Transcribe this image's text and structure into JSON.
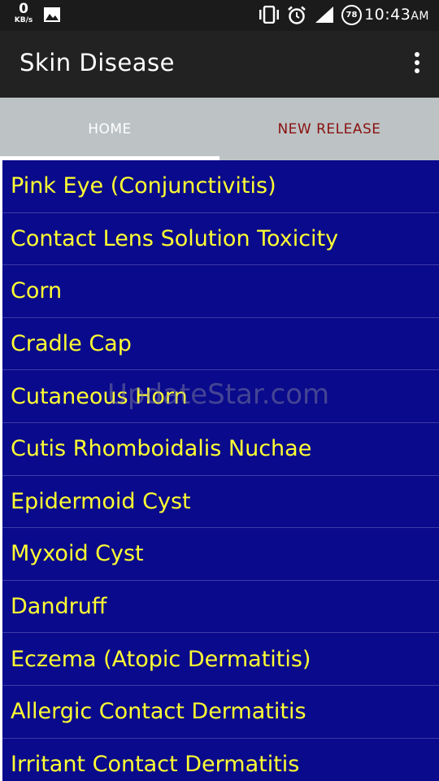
{
  "status_bar": {
    "net_speed": "0",
    "net_unit": "KB/s",
    "battery": "78",
    "time": "10:43",
    "ampm": "AM",
    "icons": [
      "image-icon",
      "vibrate-icon",
      "alarm-icon",
      "signal-icon",
      "battery-icon"
    ]
  },
  "toolbar": {
    "title": "Skin Disease",
    "menu_icon": "more-vert-icon"
  },
  "tabs": [
    {
      "label": "HOME",
      "selected": true
    },
    {
      "label": "NEW RELEASE",
      "selected": false
    }
  ],
  "diseases": [
    "Pink Eye (Conjunctivitis)",
    "Contact Lens Solution Toxicity",
    "Corn",
    "Cradle Cap",
    "Cutaneous Horn",
    "Cutis Rhomboidalis Nuchae",
    "Epidermoid Cyst",
    "Myxoid Cyst",
    "Dandruff",
    "Eczema (Atopic Dermatitis)",
    "Allergic Contact Dermatitis",
    "Irritant Contact Dermatitis"
  ],
  "watermark": "UpdateStar.com",
  "colors": {
    "list_bg": "#0a0a8c",
    "list_text": "#ffff33",
    "tab_bar": "#bdc3c4",
    "tab_inactive_text": "#8a1010"
  }
}
